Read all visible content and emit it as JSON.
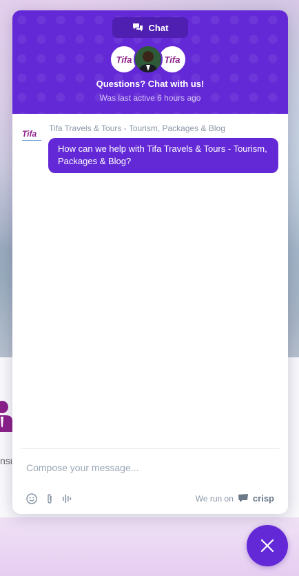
{
  "header": {
    "tab_label": "Chat",
    "avatars": [
      {
        "label": "Tifa"
      },
      {
        "label": ""
      },
      {
        "label": "Tifa"
      }
    ],
    "title": "Questions? Chat with us!",
    "status": "Was last active 6 hours ago"
  },
  "conversation": {
    "sender": "Tifa Travels & Tours - Tourism, Packages & Blog",
    "sender_logo": "Tifa",
    "message": "How can we help with Tifa Travels & Tours - Tourism, Packages & Blog?"
  },
  "composer": {
    "placeholder": "Compose your message...",
    "tools": [
      "emoji-icon",
      "attachment-icon",
      "audio-icon"
    ],
    "powered_prefix": "We run on",
    "powered_brand": "crisp"
  },
  "background": {
    "partial_text": "nsu"
  },
  "colors": {
    "accent": "#6429d6",
    "accent_dark": "#4e1fb0",
    "brand_magenta": "#8b1f8a"
  }
}
